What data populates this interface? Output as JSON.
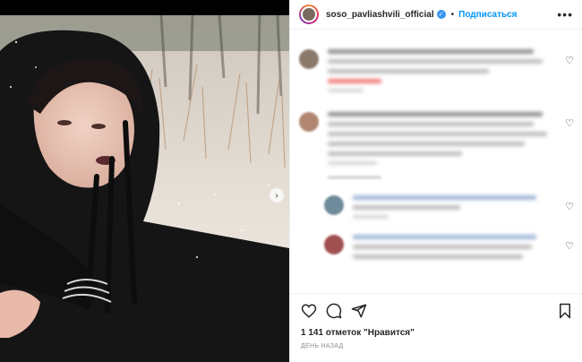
{
  "header": {
    "username": "soso_pavliashvili_official",
    "separator": "•",
    "follow_label": "Подписаться",
    "more_label": "•••"
  },
  "media": {
    "next_glyph": "›"
  },
  "comments": {
    "heart_glyph": "♡"
  },
  "icons": [
    "heart-icon",
    "comment-icon",
    "share-icon",
    "save-icon",
    "verified-icon"
  ],
  "likes": {
    "count_text": "1 141 отметок \"Нравится\""
  },
  "timestamp": "ДЕНЬ НАЗАД",
  "colors": {
    "link_blue": "#0095f6",
    "verified_blue": "#3897f0",
    "emoji_accent": "#f05a5a"
  }
}
